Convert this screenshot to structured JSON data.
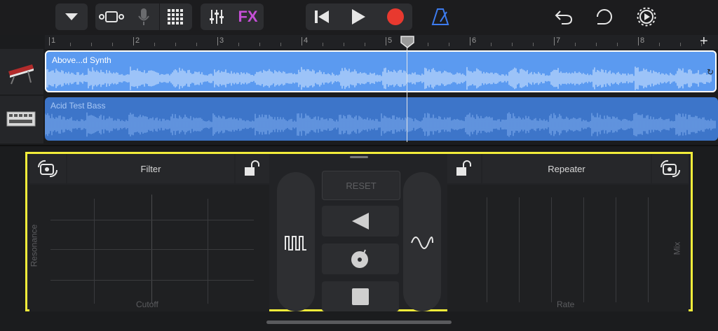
{
  "toolbar": {
    "fx_label": "FX",
    "buttons": [
      "chevron-down-icon",
      "track-view-icon",
      "microphone-icon",
      "grid-icon",
      "mixer-icon",
      "fx",
      "rewind-icon",
      "play-icon",
      "record-icon",
      "metronome-icon",
      "undo-icon",
      "loop-icon",
      "settings-icon"
    ],
    "record_color": "#e8392f",
    "metronome_color": "#3d7cf0"
  },
  "ruler": {
    "bars": [
      "1",
      "2",
      "3",
      "4",
      "5",
      "6",
      "7",
      "8"
    ],
    "add_label": "+",
    "playhead_bar": 5.25
  },
  "tracks": [
    {
      "name": "Above...d Synth",
      "selected": true,
      "color": "#5b9af0",
      "instrument": "synth-keyboard"
    },
    {
      "name": "Acid Test Bass",
      "selected": false,
      "color": "#3d75c9",
      "instrument": "drum-machine"
    }
  ],
  "panel": {
    "left": {
      "title": "Filter",
      "x_label": "Cutoff",
      "y_label": "Resonance"
    },
    "right": {
      "title": "Repeater",
      "x_label": "Rate",
      "y_label": "Mix"
    },
    "reset_label": "RESET",
    "highlight_color": "#f2ec3a"
  }
}
